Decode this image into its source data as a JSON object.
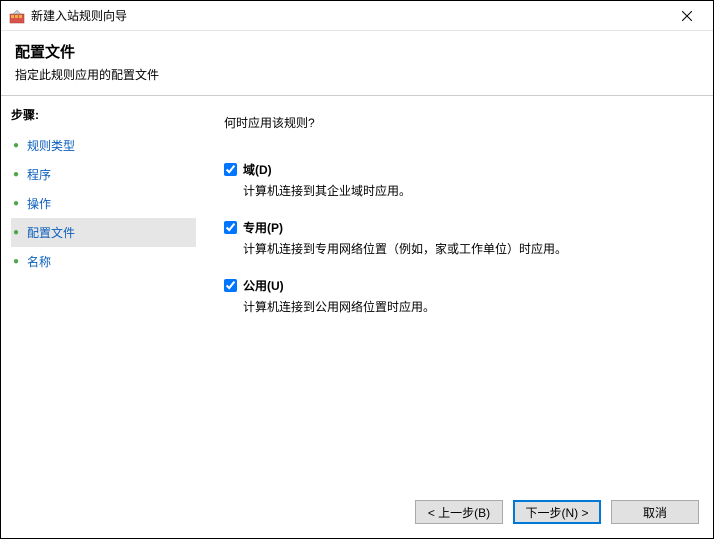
{
  "titlebar": {
    "title": "新建入站规则向导"
  },
  "header": {
    "heading": "配置文件",
    "subheading": "指定此规则应用的配置文件"
  },
  "sidebar": {
    "title": "步骤:",
    "steps": [
      {
        "label": "规则类型"
      },
      {
        "label": "程序"
      },
      {
        "label": "操作"
      },
      {
        "label": "配置文件"
      },
      {
        "label": "名称"
      }
    ]
  },
  "content": {
    "question": "何时应用该规则?",
    "checkboxes": [
      {
        "label": "域(D)",
        "desc": "计算机连接到其企业域时应用。",
        "checked": true
      },
      {
        "label": "专用(P)",
        "desc": "计算机连接到专用网络位置（例如，家或工作单位）时应用。",
        "checked": true
      },
      {
        "label": "公用(U)",
        "desc": "计算机连接到公用网络位置时应用。",
        "checked": true
      }
    ]
  },
  "footer": {
    "back": "< 上一步(B)",
    "next": "下一步(N) >",
    "cancel": "取消"
  }
}
